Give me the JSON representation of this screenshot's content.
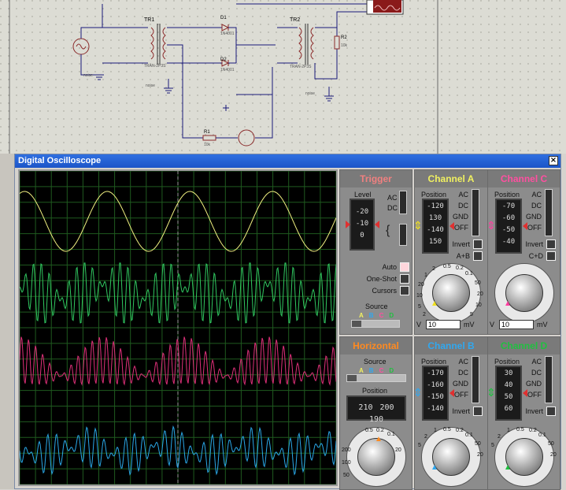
{
  "schematic": {
    "components": {
      "tr1": "TR1",
      "tr2": "TR2",
      "d1": "D1",
      "d2": "D2",
      "r1": "R1",
      "r2": "R2",
      "tr1_sub": "TRAN-2P3S",
      "tr2_sub": "TRAN-2P3S",
      "d1_sub": "1N4001",
      "d2_sub": "1N4001",
      "r1_sub": "10k",
      "r2_sub": "10k",
      "gnd1": "noise",
      "gnd2": "noise",
      "gnd3": "noise"
    }
  },
  "window": {
    "title": "Digital Oscilloscope",
    "close": "×"
  },
  "trigger": {
    "title": "Trigger",
    "level": "Level",
    "ac": "AC",
    "dc": "DC",
    "level_scale": [
      "-20",
      "-10",
      "0"
    ],
    "auto": "Auto",
    "one_shot": "One-Shot",
    "cursors": "Cursors",
    "source": "Source",
    "source_letters": [
      "A",
      "B",
      "C",
      "D"
    ]
  },
  "channel_a": {
    "title": "Channel A",
    "position": "Position",
    "scale": [
      "-120",
      "130",
      "-140",
      "150"
    ],
    "ac": "AC",
    "dc": "DC",
    "gnd": "GND",
    "off": "OFF",
    "invert": "Invert",
    "combine": "A+B",
    "knob_scale": [
      "0.5",
      "0.2",
      "0.1",
      "50",
      "20",
      "10",
      "5",
      "2",
      "1",
      "20",
      "10",
      "5",
      "2"
    ],
    "value": "10",
    "unit_left": "V",
    "unit_right": "mV"
  },
  "channel_c": {
    "title": "Channel C",
    "position": "Position",
    "scale": [
      "-70",
      "-60",
      "-50",
      "-40"
    ],
    "ac": "AC",
    "dc": "DC",
    "gnd": "GND",
    "off": "OFF",
    "invert": "Invert",
    "combine": "C+D",
    "value": "10",
    "unit_left": "V",
    "unit_right": "mV"
  },
  "horizontal": {
    "title": "Horizontal",
    "source": "Source",
    "source_letters": [
      "A",
      "B",
      "C",
      "D"
    ],
    "position": "Position",
    "position_scale": [
      "210",
      "200",
      "190"
    ],
    "knob_scale": [
      "0.5",
      "0.2",
      "0.1",
      "200",
      "100",
      "50",
      "20"
    ]
  },
  "channel_b": {
    "title": "Channel B",
    "position": "Position",
    "scale": [
      "-170",
      "-160",
      "-150",
      "-140"
    ],
    "ac": "AC",
    "dc": "DC",
    "gnd": "GND",
    "off": "OFF",
    "invert": "Invert",
    "knob_scale": [
      "1",
      "0.5",
      "0.2",
      "0.1",
      "2",
      "50",
      "5",
      "20"
    ]
  },
  "channel_d": {
    "title": "Channel D",
    "position": "Position",
    "scale": [
      "30",
      "40",
      "50",
      "60"
    ],
    "ac": "AC",
    "dc": "DC",
    "gnd": "GND",
    "off": "OFF",
    "invert": "Invert",
    "knob_scale": [
      "1",
      "0.5",
      "0.2",
      "0.1",
      "2",
      "50",
      "5",
      "20"
    ]
  },
  "colors": {
    "trace_a": "#f0f080",
    "trace_b": "#2aa8e8",
    "trace_c": "#e0307a",
    "trace_d": "#30c860",
    "title_trigger": "#f08080",
    "title_a": "#f0f060",
    "title_b": "#30a8f0",
    "title_c": "#ff4fa0",
    "title_d": "#20c040",
    "title_horizontal": "#ff8a20"
  }
}
